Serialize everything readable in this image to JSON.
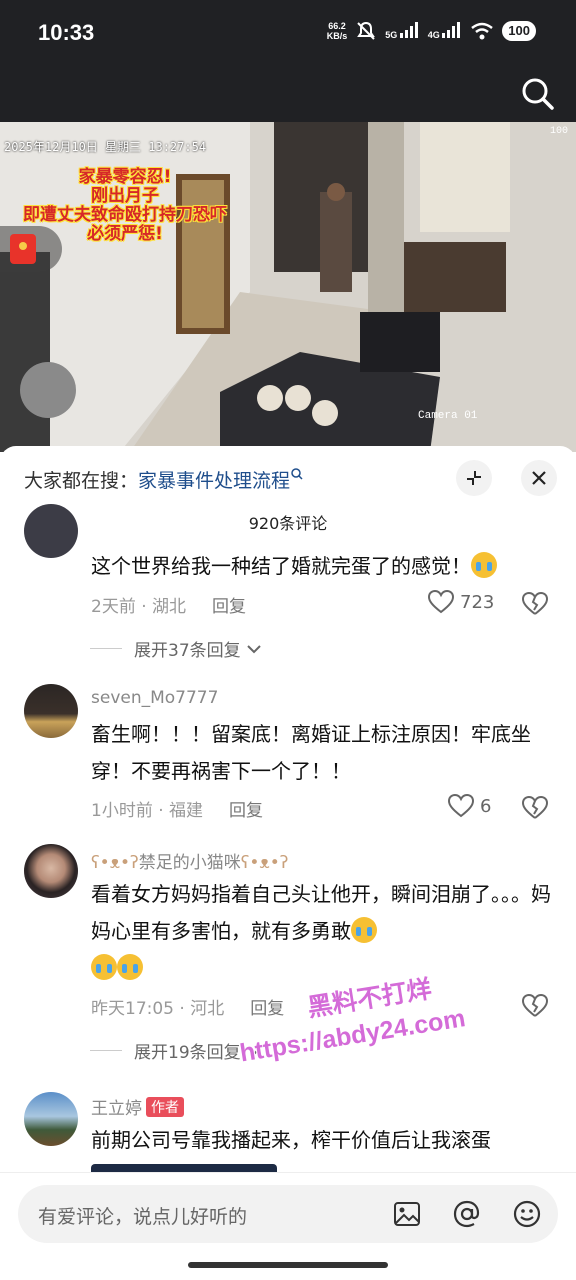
{
  "status_bar": {
    "time": "10:33",
    "net_speed_value": "66.2",
    "net_speed_unit": "KB/s",
    "signal_1": "5G",
    "signal_2": "4G",
    "battery": "100"
  },
  "video": {
    "timestamp": "2025年12月10日  星期三  13:27:54",
    "camera_signal": "100",
    "camera_label": "Camera 01",
    "overlay_lines": [
      "家暴零容忍!",
      "刚出月子",
      "即遭丈夫致命殴打持刀恐吓",
      "必须严惩!"
    ],
    "icons": [
      "search-icon",
      "red-packet-icon"
    ]
  },
  "sheet": {
    "hot_search_prefix": "大家都在搜：",
    "hot_search_keyword": "家暴事件处理流程",
    "comment_count": "920条评论",
    "icons": [
      "shrink-icon",
      "close-icon"
    ]
  },
  "comments": [
    {
      "text": "这个世界给我一种结了婚就完蛋了的感觉！",
      "time": "2天前",
      "location": "湖北",
      "reply_label": "回复",
      "likes": "723",
      "expand": "展开37条回复"
    },
    {
      "username": "seven_Mo7777",
      "text": "畜生啊！！！留案底！离婚证上标注原因！牢底坐穿！不要再祸害下一个了！！",
      "time": "1小时前",
      "location": "福建",
      "reply_label": "回复",
      "likes": "6"
    },
    {
      "username": "禁足的小猫咪",
      "text": "看着女方妈妈指着自己头让他开，瞬间泪崩了。。。妈妈心里有多害怕，就有多勇敢",
      "time": "昨天17:05",
      "location": "河北",
      "reply_label": "回复",
      "expand": "展开19条回复"
    },
    {
      "username": "王立婷",
      "author_tag": "作者",
      "text": "前期公司号靠我播起来，榨干价值后让我滚蛋"
    }
  ],
  "watermark": {
    "line1": "黑料不打烊",
    "line2": "https://abdy24.com"
  },
  "input_bar": {
    "placeholder": "有爱评论，说点儿好听的",
    "icons": [
      "image-icon",
      "at-icon",
      "emoji-icon"
    ]
  },
  "colors": {
    "link_blue": "#1f4e8c",
    "author_tag_red": "#e94e5b",
    "overlay_red": "#d62828",
    "watermark_pink": "#d46bd8"
  }
}
